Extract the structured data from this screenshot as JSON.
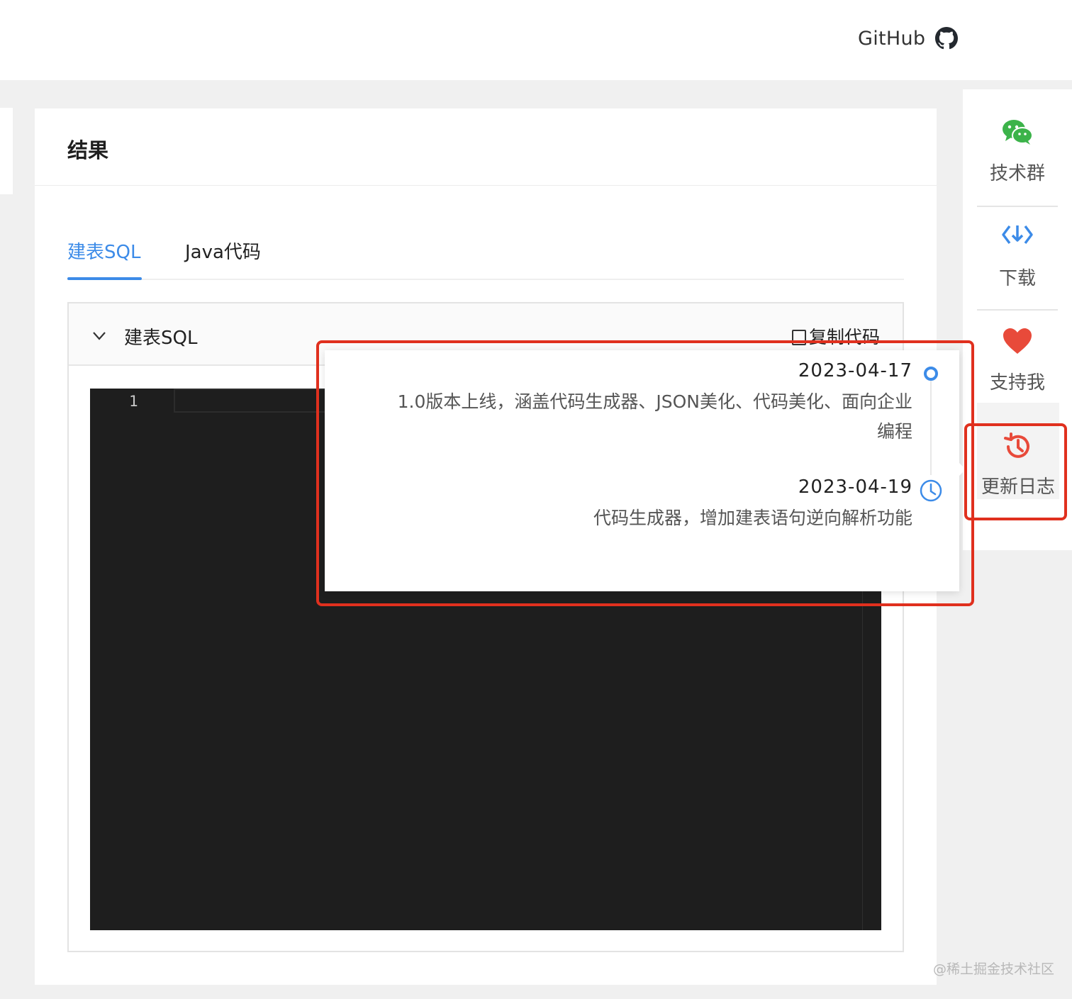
{
  "header": {
    "github_label": "GitHub"
  },
  "result_card": {
    "title": "结果",
    "tabs": [
      {
        "label": "建表SQL",
        "active": true
      },
      {
        "label": "Java代码",
        "active": false
      }
    ],
    "panel": {
      "title": "建表SQL",
      "copy_label": "复制代码",
      "editor": {
        "line_numbers": [
          "1"
        ],
        "theme": "dark"
      }
    }
  },
  "sidebar": {
    "items": [
      {
        "label": "技术群",
        "icon": "wechat-icon",
        "color": "#3cb34a"
      },
      {
        "label": "下载",
        "icon": "download-icon",
        "color": "#3c8be8"
      },
      {
        "label": "支持我",
        "icon": "heart-icon",
        "color": "#e84a3a"
      },
      {
        "label": "更新日志",
        "icon": "history-icon",
        "color": "#e84a3a",
        "active": true
      }
    ]
  },
  "changelog": {
    "entries": [
      {
        "date": "2023-04-17",
        "content_line1": "1.0版本上线，涵盖代码生成器、JSON美化、代码美化、面向企业",
        "content_line2": "编程"
      },
      {
        "date": "2023-04-19",
        "content_line1": "代码生成器，增加建表语句逆向解析功能"
      }
    ]
  },
  "colors": {
    "accent": "#3c8be8",
    "highlight": "#e0301e",
    "editor_bg": "#1e1e1e"
  },
  "watermark": "@稀土掘金技术社区"
}
